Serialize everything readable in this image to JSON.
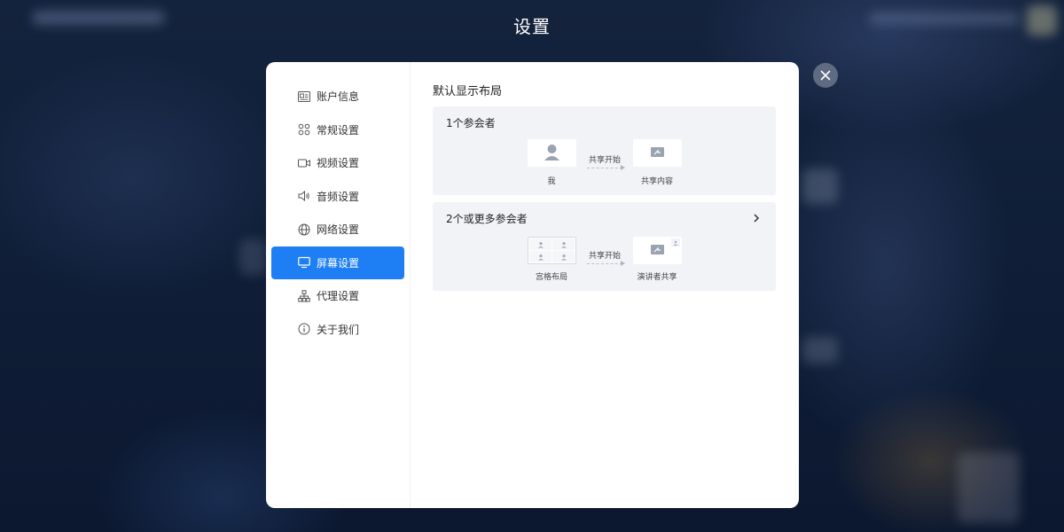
{
  "header": {
    "title": "设置"
  },
  "sidebar": {
    "items": [
      {
        "label": "账户信息",
        "icon": "id-card-icon"
      },
      {
        "label": "常规设置",
        "icon": "grid-circles-icon"
      },
      {
        "label": "视频设置",
        "icon": "video-camera-icon"
      },
      {
        "label": "音频设置",
        "icon": "speaker-icon"
      },
      {
        "label": "网络设置",
        "icon": "globe-icon"
      },
      {
        "label": "屏幕设置",
        "icon": "monitor-icon",
        "active": true
      },
      {
        "label": "代理设置",
        "icon": "network-tree-icon"
      },
      {
        "label": "关于我们",
        "icon": "info-icon"
      }
    ]
  },
  "main": {
    "section_title": "默认显示布局",
    "cards": [
      {
        "title": "1个参会者",
        "from_label": "我",
        "arrow_label": "共享开始",
        "to_label": "共享内容"
      },
      {
        "title": "2个或更多参会者",
        "from_label": "宫格布局",
        "arrow_label": "共享开始",
        "to_label": "演讲者共享"
      }
    ]
  },
  "colors": {
    "accent": "#1e7ff5",
    "card_bg": "#f1f3f6",
    "close_button_bg": "#5f6b80"
  }
}
